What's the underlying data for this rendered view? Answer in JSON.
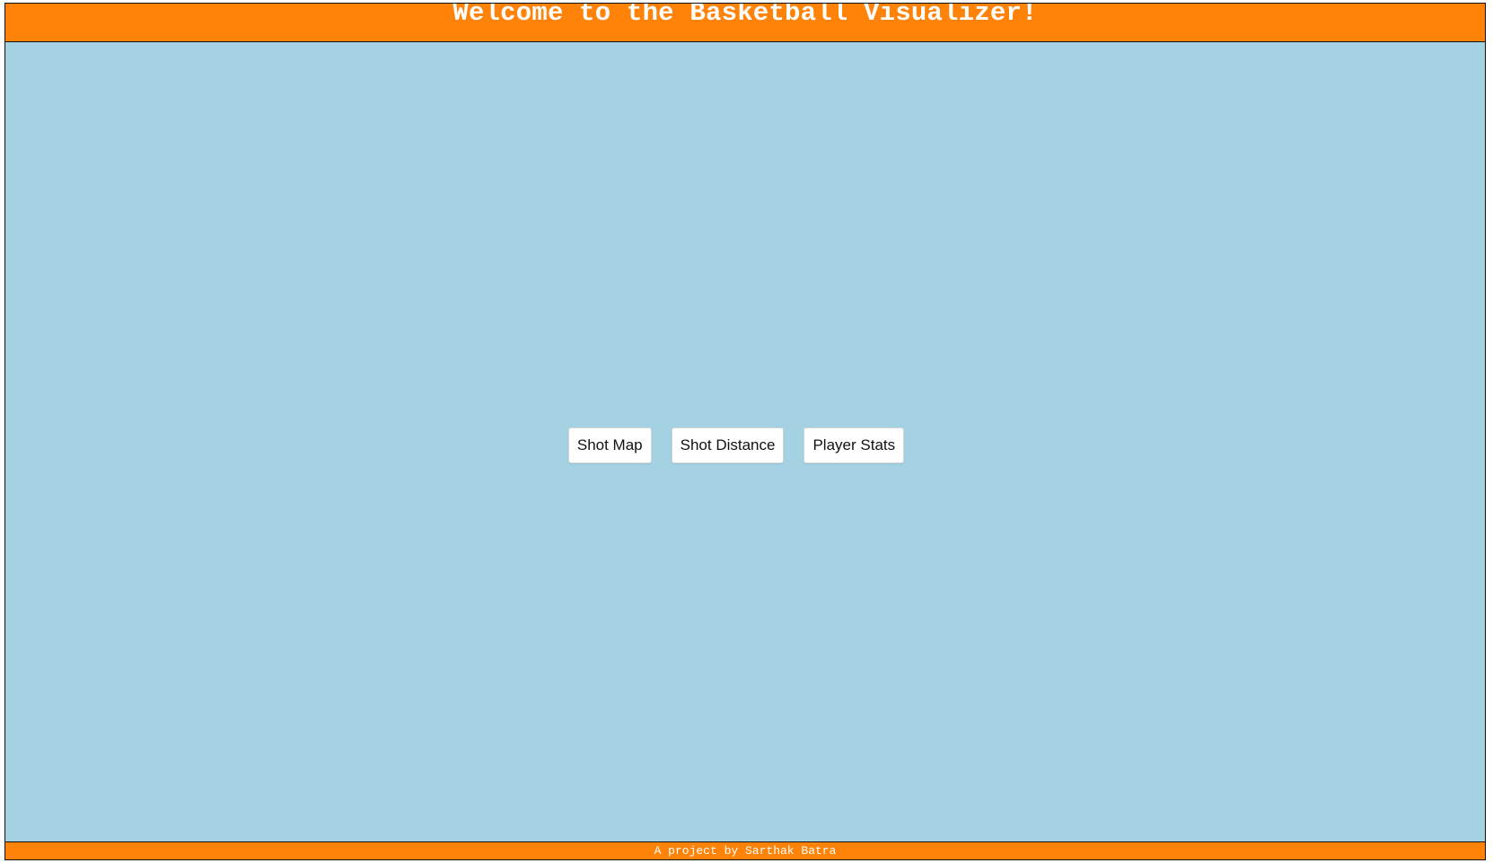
{
  "header": {
    "title": "Welcome to the Basketball Visualizer!"
  },
  "main": {
    "buttons": [
      {
        "label": "Shot Map"
      },
      {
        "label": "Shot Distance"
      },
      {
        "label": "Player Stats"
      }
    ]
  },
  "footer": {
    "credit": "A project by Sarthak Batra"
  },
  "colors": {
    "header_background": "#ff8308",
    "page_background": "#a5d2e2",
    "button_background": "#ffffff"
  }
}
